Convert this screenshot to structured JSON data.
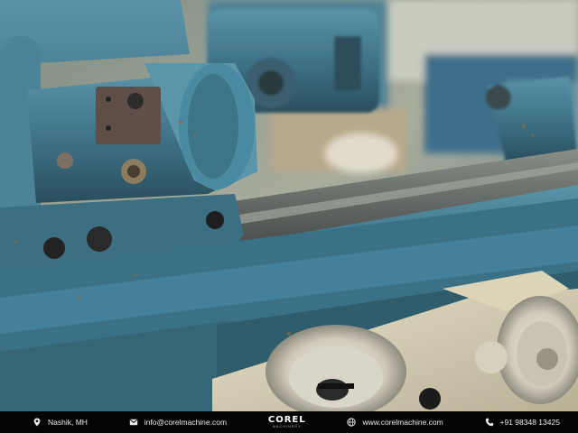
{
  "photo": {
    "subject": "blue industrial cylindrical grinding machine, close-up of worktable, slide rail, hydraulic motor housing and handwheel",
    "colors": {
      "machine_blue": "#4a7f95",
      "machine_dark": "#2b4a57",
      "cream": "#d9d2b6",
      "background": "#9aa39a"
    }
  },
  "footer": {
    "location": {
      "icon": "location-pin-icon",
      "text": "Nashik, MH"
    },
    "email": {
      "icon": "email-icon",
      "text": "info@corelmachine.com"
    },
    "brand": {
      "name": "COREL",
      "tagline": "MACHINERY"
    },
    "website": {
      "icon": "globe-icon",
      "text": "www.corelmachine.com"
    },
    "phone": {
      "icon": "phone-icon",
      "text": "+91 98348 13425"
    },
    "colors": {
      "bar": "#050505",
      "text": "#e9e9e9"
    }
  }
}
